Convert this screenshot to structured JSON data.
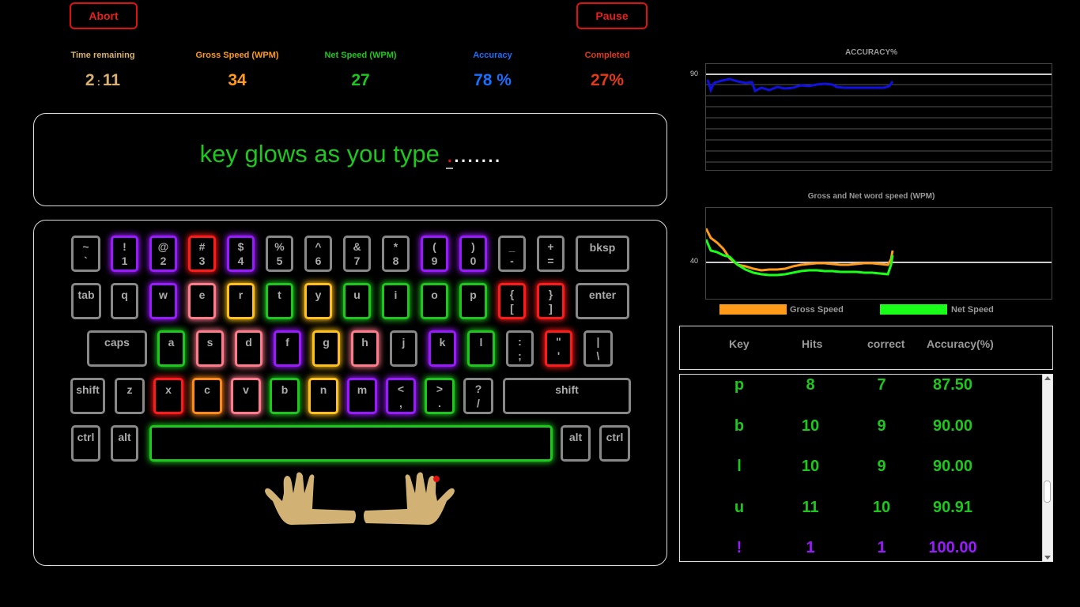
{
  "buttons": {
    "abort": "Abort",
    "pause": "Pause"
  },
  "stats": [
    {
      "label": "Time remaining",
      "value_min": "2",
      "value_sep": ":",
      "value_sec": "11",
      "label_color": "#d8b070",
      "value_color": "#d8b070"
    },
    {
      "label": "Gross Speed (WPM)",
      "value": "34",
      "label_color": "#ff9a1a",
      "value_color": "#ff9a1a"
    },
    {
      "label": "Net Speed (WPM)",
      "value": "27",
      "label_color": "#1ec71e",
      "value_color": "#1ec71e"
    },
    {
      "label": "Accuracy",
      "value": "78 %",
      "label_color": "#1a6fff",
      "value_color": "#1a6fff"
    },
    {
      "label": "Completed",
      "value": "27%",
      "label_color": "#e03a1a",
      "value_color": "#e03a1a"
    }
  ],
  "typing": {
    "text": "key glows as you type ",
    "cursor_char": ".",
    "remaining": "......."
  },
  "keyboard": {
    "row1": [
      {
        "top": "~",
        "bottom": "`",
        "glow": "none"
      },
      {
        "top": "!",
        "bottom": "1",
        "glow": "#9a1aff"
      },
      {
        "top": "@",
        "bottom": "2",
        "glow": "#9a1aff"
      },
      {
        "top": "#",
        "bottom": "3",
        "glow": "#ff1a1a"
      },
      {
        "top": "$",
        "bottom": "4",
        "glow": "#9a1aff"
      },
      {
        "top": "%",
        "bottom": "5",
        "glow": "none"
      },
      {
        "top": "^",
        "bottom": "6",
        "glow": "none"
      },
      {
        "top": "&",
        "bottom": "7",
        "glow": "none"
      },
      {
        "top": "*",
        "bottom": "8",
        "glow": "none"
      },
      {
        "top": "(",
        "bottom": "9",
        "glow": "#9a1aff"
      },
      {
        "top": ")",
        "bottom": "0",
        "glow": "#9a1aff"
      },
      {
        "top": "_",
        "bottom": "-",
        "glow": "none"
      },
      {
        "top": "+",
        "bottom": "=",
        "glow": "none"
      },
      {
        "label": "bksp",
        "glow": "none"
      }
    ],
    "row2": [
      {
        "label": "tab",
        "glow": "none"
      },
      {
        "label": "q",
        "glow": "none"
      },
      {
        "label": "w",
        "glow": "#9a1aff"
      },
      {
        "label": "e",
        "glow": "#ff7a8a"
      },
      {
        "label": "r",
        "glow": "#ffc01a"
      },
      {
        "label": "t",
        "glow": "#1ec71e"
      },
      {
        "label": "y",
        "glow": "#ffc01a"
      },
      {
        "label": "u",
        "glow": "#1ec71e"
      },
      {
        "label": "i",
        "glow": "#1ec71e"
      },
      {
        "label": "o",
        "glow": "#1ec71e"
      },
      {
        "label": "p",
        "glow": "#1ec71e"
      },
      {
        "top": "{",
        "bottom": "[",
        "glow": "#ff1a1a"
      },
      {
        "top": "}",
        "bottom": "]",
        "glow": "#ff1a1a"
      },
      {
        "label": "enter",
        "glow": "none"
      }
    ],
    "row3": [
      {
        "label": "caps",
        "glow": "none"
      },
      {
        "label": "a",
        "glow": "#1ec71e"
      },
      {
        "label": "s",
        "glow": "#ff7a8a"
      },
      {
        "label": "d",
        "glow": "#ff7a8a"
      },
      {
        "label": "f",
        "glow": "#9a1aff"
      },
      {
        "label": "g",
        "glow": "#ffc01a"
      },
      {
        "label": "h",
        "glow": "#ff7a8a"
      },
      {
        "label": "j",
        "glow": "none"
      },
      {
        "label": "k",
        "glow": "#9a1aff"
      },
      {
        "label": "l",
        "glow": "#1ec71e"
      },
      {
        "top": ":",
        "bottom": ";",
        "glow": "none"
      },
      {
        "top": "\"",
        "bottom": "'",
        "glow": "#ff1a1a"
      },
      {
        "top": "|",
        "bottom": "\\",
        "glow": "none"
      }
    ],
    "row4": [
      {
        "label": "shift",
        "glow": "none"
      },
      {
        "label": "z",
        "glow": "none"
      },
      {
        "label": "x",
        "glow": "#ff1a1a"
      },
      {
        "label": "c",
        "glow": "#ff8a1a"
      },
      {
        "label": "v",
        "glow": "#ff7a8a"
      },
      {
        "label": "b",
        "glow": "#1ec71e"
      },
      {
        "label": "n",
        "glow": "#ffc01a"
      },
      {
        "label": "m",
        "glow": "#9a1aff"
      },
      {
        "top": "<",
        "bottom": ",",
        "glow": "#9a1aff"
      },
      {
        "top": ">",
        "bottom": ".",
        "glow": "#1ec71e"
      },
      {
        "top": "?",
        "bottom": "/",
        "glow": "none"
      },
      {
        "label": "shift",
        "glow": "none"
      }
    ],
    "row5": [
      {
        "label": "ctrl",
        "glow": "none"
      },
      {
        "label": "alt",
        "glow": "none"
      },
      {
        "label": "",
        "glow": "#1ec71e"
      },
      {
        "label": "alt",
        "glow": "none"
      },
      {
        "label": "ctrl",
        "glow": "none"
      }
    ]
  },
  "accuracy_chart": {
    "title": "ACCURACY%",
    "tick_label": "90",
    "line_color": "#1010e0"
  },
  "speed_chart": {
    "title": "Gross and Net word speed (WPM)",
    "tick_label": "40",
    "legend": [
      {
        "name": "Gross Speed",
        "color": "#ff9a1a"
      },
      {
        "name": "Net Speed",
        "color": "#1aff1a"
      }
    ]
  },
  "table": {
    "headers": [
      "Key",
      "Hits",
      "correct",
      "Accuracy(%)"
    ],
    "rows": [
      {
        "key": "p",
        "hits": "8",
        "correct": "7",
        "accuracy": "87.50",
        "color": "#1ec71e"
      },
      {
        "key": "b",
        "hits": "10",
        "correct": "9",
        "accuracy": "90.00",
        "color": "#1ec71e"
      },
      {
        "key": "l",
        "hits": "10",
        "correct": "9",
        "accuracy": "90.00",
        "color": "#1ec71e"
      },
      {
        "key": "u",
        "hits": "11",
        "correct": "10",
        "accuracy": "90.91",
        "color": "#1ec71e"
      },
      {
        "key": "!",
        "hits": "1",
        "correct": "1",
        "accuracy": "100.00",
        "color": "#9a1aff"
      }
    ]
  }
}
